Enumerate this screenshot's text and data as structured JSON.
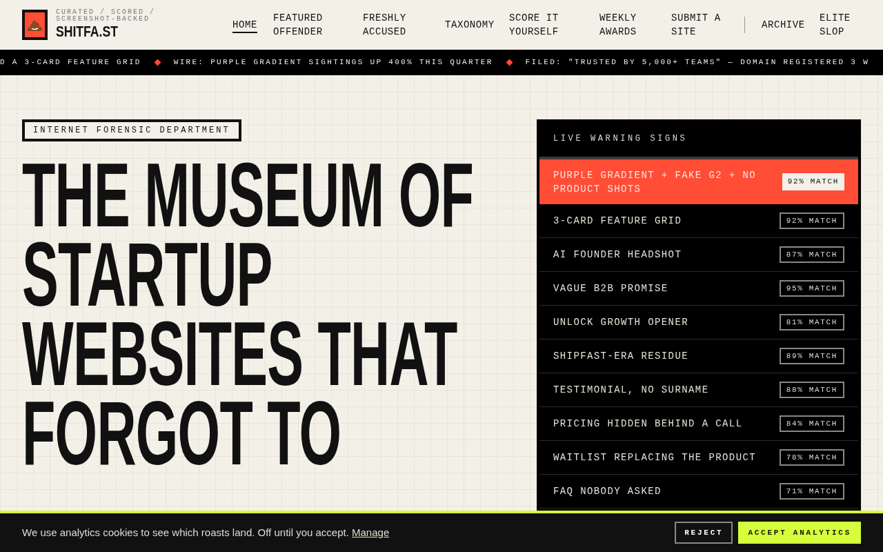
{
  "brand": {
    "tagline": "CURATED / SCORED / SCREENSHOT-BACKED",
    "name": "SHITFA.ST"
  },
  "nav": [
    {
      "label": "HOME",
      "selected": true,
      "divider_before": false
    },
    {
      "label": "FEATURED OFFENDER",
      "selected": false,
      "divider_before": false
    },
    {
      "label": "FRESHLY ACCUSED",
      "selected": false,
      "divider_before": false
    },
    {
      "label": "TAXONOMY",
      "selected": false,
      "divider_before": false
    },
    {
      "label": "SCORE IT YOURSELF",
      "selected": false,
      "divider_before": false
    },
    {
      "label": "WEEKLY AWARDS",
      "selected": false,
      "divider_before": false
    },
    {
      "label": "SUBMIT A SITE",
      "selected": false,
      "divider_before": false
    },
    {
      "label": "ARCHIVE",
      "selected": false,
      "divider_before": true
    },
    {
      "label": "ELITE SLOP",
      "selected": false,
      "divider_before": false
    }
  ],
  "ticker": [
    "D A 3-CARD FEATURE GRID",
    "WIRE: PURPLE GRADIENT SIGHTINGS UP 400% THIS QUARTER",
    "FILED: \"TRUSTED BY 5,000+ TEAMS\" — DOMAIN REGISTERED 3 W"
  ],
  "hero": {
    "eyebrow": "INTERNET FORENSIC DEPARTMENT",
    "headline_lines": [
      "THE MUSEUM OF",
      "STARTUP",
      "WEBSITES THAT",
      "FORGOT TO"
    ]
  },
  "warning_panel": {
    "title": "LIVE WARNING SIGNS",
    "rows": [
      {
        "label": "PURPLE GRADIENT + FAKE G2 + NO PRODUCT SHOTS",
        "match": "92% MATCH",
        "selected": true
      },
      {
        "label": "3-CARD FEATURE GRID",
        "match": "92% MATCH",
        "selected": false
      },
      {
        "label": "AI FOUNDER HEADSHOT",
        "match": "87% MATCH",
        "selected": false
      },
      {
        "label": "VAGUE B2B PROMISE",
        "match": "95% MATCH",
        "selected": false
      },
      {
        "label": "UNLOCK GROWTH OPENER",
        "match": "81% MATCH",
        "selected": false
      },
      {
        "label": "SHIPFAST-ERA RESIDUE",
        "match": "89% MATCH",
        "selected": false
      },
      {
        "label": "TESTIMONIAL, NO SURNAME",
        "match": "88% MATCH",
        "selected": false
      },
      {
        "label": "PRICING HIDDEN BEHIND A CALL",
        "match": "84% MATCH",
        "selected": false
      },
      {
        "label": "WAITLIST REPLACING THE PRODUCT",
        "match": "78% MATCH",
        "selected": false
      },
      {
        "label": "FAQ NOBODY ASKED",
        "match": "71% MATCH",
        "selected": false
      }
    ]
  },
  "cookie_banner": {
    "text": "We use analytics cookies to see which roasts land. Off until you accept.",
    "link": "Manage",
    "buttons": [
      {
        "label": "REJECT",
        "kind": "secondary"
      },
      {
        "label": "ACCEPT ANALYTICS",
        "kind": "primary"
      }
    ]
  }
}
